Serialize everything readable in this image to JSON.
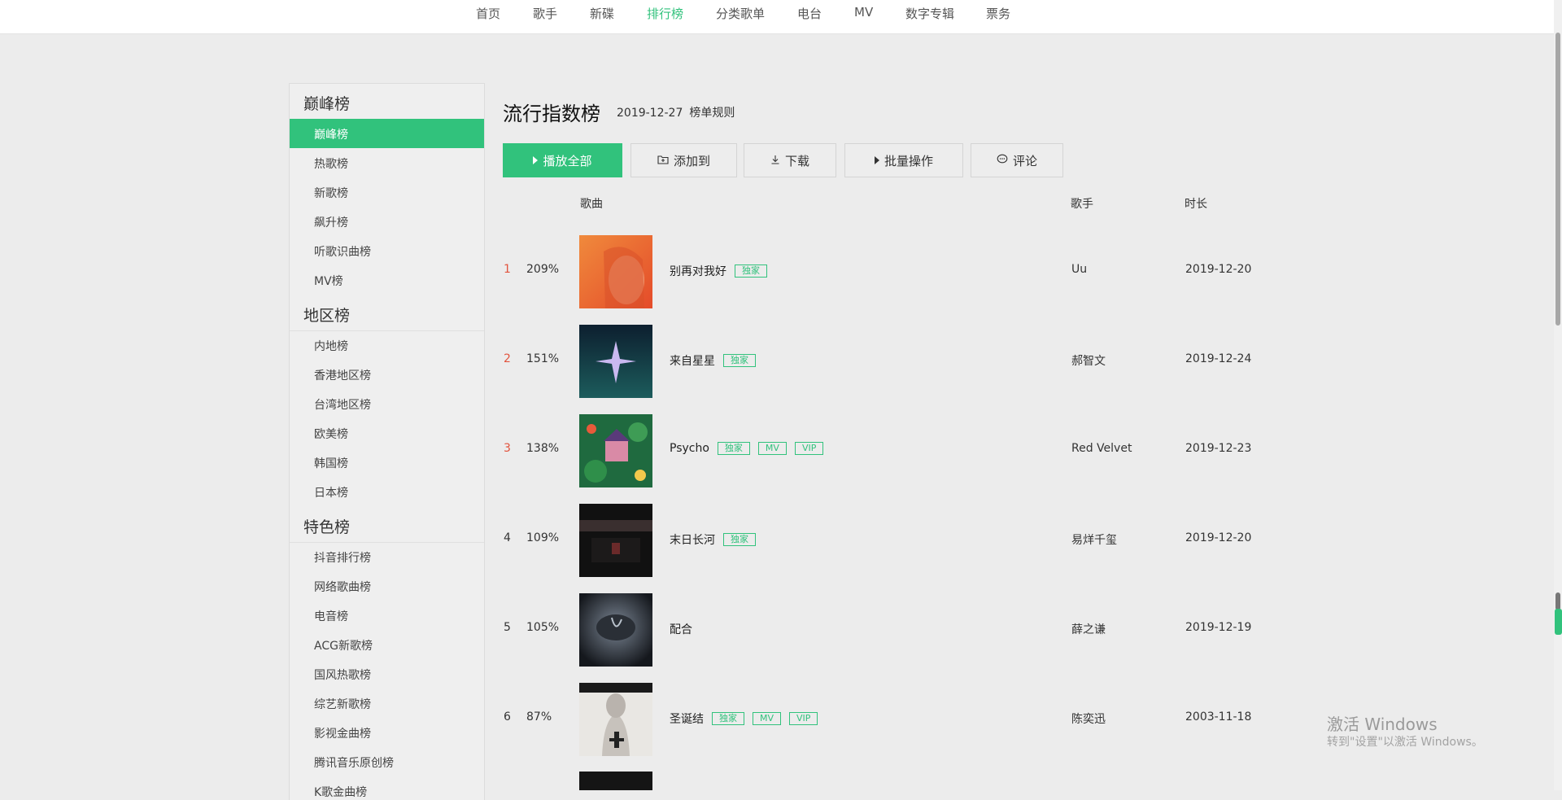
{
  "nav": {
    "items": [
      {
        "label": "首页"
      },
      {
        "label": "歌手"
      },
      {
        "label": "新碟"
      },
      {
        "label": "排行榜"
      },
      {
        "label": "分类歌单"
      },
      {
        "label": "电台"
      },
      {
        "label": "MV"
      },
      {
        "label": "数字专辑"
      },
      {
        "label": "票务"
      }
    ],
    "active_index": 3
  },
  "sidebar": {
    "groups": [
      {
        "title": "巅峰榜",
        "items": [
          "巅峰榜",
          "热歌榜",
          "新歌榜",
          "飙升榜",
          "听歌识曲榜",
          "MV榜"
        ]
      },
      {
        "title": "地区榜",
        "items": [
          "内地榜",
          "香港地区榜",
          "台湾地区榜",
          "欧美榜",
          "韩国榜",
          "日本榜"
        ]
      },
      {
        "title": "特色榜",
        "items": [
          "抖音排行榜",
          "网络歌曲榜",
          "电音榜",
          "ACG新歌榜",
          "国风热歌榜",
          "综艺新歌榜",
          "影视金曲榜",
          "腾讯音乐原创榜",
          "K歌金曲榜"
        ]
      }
    ],
    "active_item": "巅峰榜"
  },
  "list": {
    "title": "流行指数榜",
    "date": "2019-12-27",
    "rules_link": "榜单规则"
  },
  "toolbar": {
    "play_all": "播放全部",
    "add_to": "添加到",
    "download": "下载",
    "batch": "批量操作",
    "comment": "评论"
  },
  "columns": {
    "song": "歌曲",
    "singer": "歌手",
    "duration": "时长"
  },
  "songs": [
    {
      "rank": "1",
      "pct": "209%",
      "name": "别再对我好",
      "tags": [
        "独家"
      ],
      "singer": "Uu",
      "date": "2019-12-20"
    },
    {
      "rank": "2",
      "pct": "151%",
      "name": "来自星星",
      "tags": [
        "独家"
      ],
      "singer": "郝智文",
      "date": "2019-12-24"
    },
    {
      "rank": "3",
      "pct": "138%",
      "name": "Psycho",
      "tags": [
        "独家",
        "MV",
        "VIP"
      ],
      "singer": "Red Velvet",
      "date": "2019-12-23"
    },
    {
      "rank": "4",
      "pct": "109%",
      "name": "末日长河",
      "tags": [
        "独家"
      ],
      "singer": "易烊千玺",
      "date": "2019-12-20"
    },
    {
      "rank": "5",
      "pct": "105%",
      "name": "配合",
      "tags": [],
      "singer": "薛之谦",
      "date": "2019-12-19"
    },
    {
      "rank": "6",
      "pct": "87%",
      "name": "圣诞结",
      "tags": [
        "独家",
        "MV",
        "VIP"
      ],
      "singer": "陈奕迅",
      "date": "2003-11-18"
    }
  ],
  "watermark": {
    "title": "激活 Windows",
    "subtitle": "转到\"设置\"以激活 Windows。"
  },
  "colors": {
    "accent": "#31c27c",
    "rank_top": "#e2533d"
  }
}
